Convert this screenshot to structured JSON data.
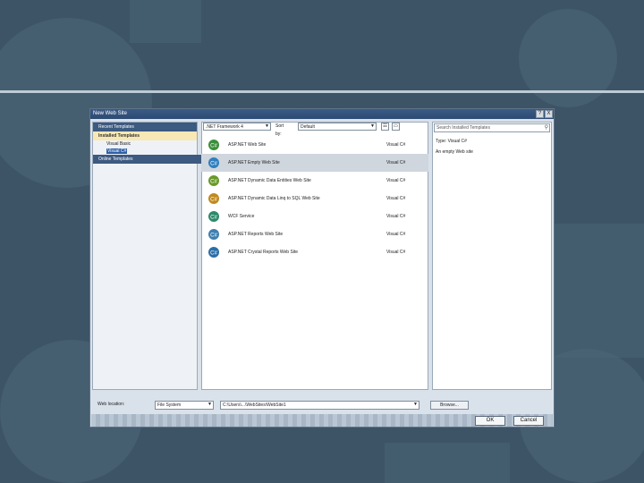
{
  "dialog": {
    "title": "New Web Site",
    "help_button": "?",
    "close_button": "X"
  },
  "left_pane": {
    "recent": "Recent Templates",
    "installed": "Installed Templates",
    "languages": [
      "Visual Basic",
      "Visual C#"
    ],
    "selected_language": "Visual C#",
    "online": "Online Templates"
  },
  "toolbar": {
    "framework": ".NET Framework 4",
    "sort_label": "Sort by:",
    "sort_value": "Default"
  },
  "templates": [
    {
      "name": "ASP.NET Web Site",
      "lang": "Visual C#",
      "icon": "web-site-icon",
      "selected": false
    },
    {
      "name": "ASP.NET Empty Web Site",
      "lang": "Visual C#",
      "icon": "empty-web-site-icon",
      "selected": true
    },
    {
      "name": "ASP.NET Dynamic Data Entities Web Site",
      "lang": "Visual C#",
      "icon": "dynamic-data-icon",
      "selected": false
    },
    {
      "name": "ASP.NET Dynamic Data Linq to SQL Web Site",
      "lang": "Visual C#",
      "icon": "dynamic-data-linq-icon",
      "selected": false
    },
    {
      "name": "WCF Service",
      "lang": "Visual C#",
      "icon": "wcf-service-icon",
      "selected": false
    },
    {
      "name": "ASP.NET Reports Web Site",
      "lang": "Visual C#",
      "icon": "reports-icon",
      "selected": false
    },
    {
      "name": "ASP.NET Crystal Reports Web Site",
      "lang": "Visual C#",
      "icon": "crystal-reports-icon",
      "selected": false
    }
  ],
  "right_pane": {
    "search_placeholder": "Search Installed Templates",
    "type_text": "Type: Visual C#",
    "description": "An empty Web site"
  },
  "bottom": {
    "location_label": "Web location:",
    "location_type": "File System",
    "location_path": "C:\\Users\\...\\WebSites\\WebSite1",
    "browse_label": "Browse...",
    "ok_label": "OK",
    "cancel_label": "Cancel"
  }
}
